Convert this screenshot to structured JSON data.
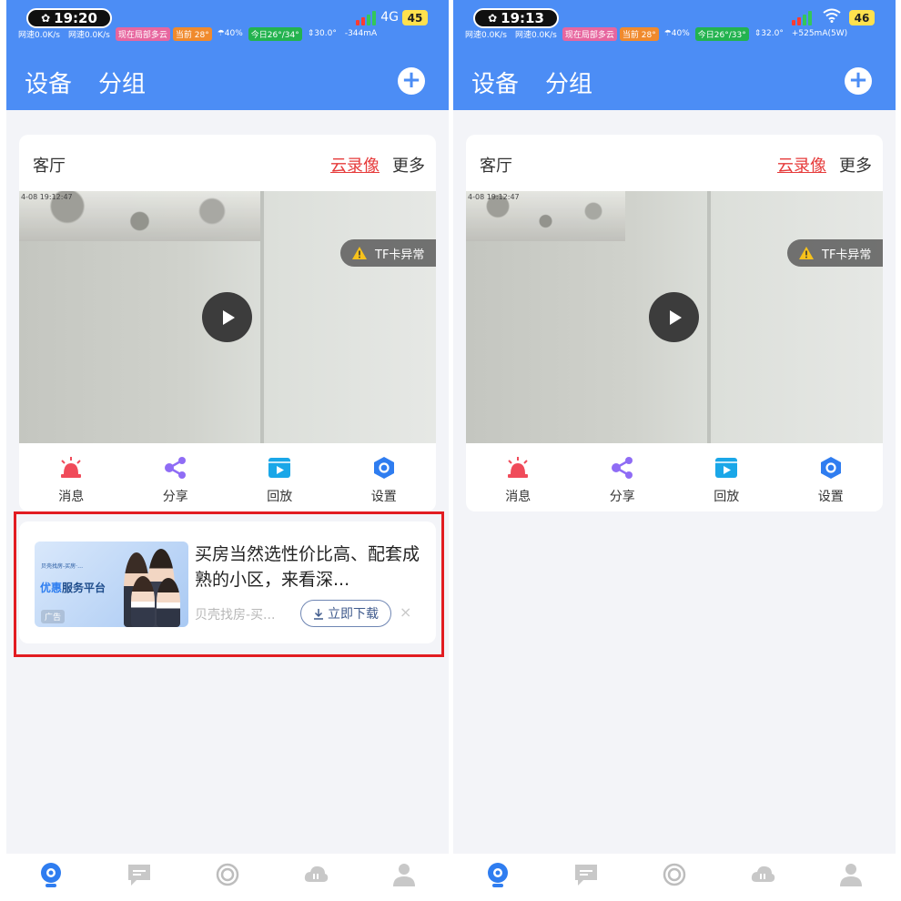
{
  "left_phone": {
    "status": {
      "time": "19:20",
      "network": "4G",
      "battery": "45",
      "tags": [
        {
          "text": "网速0.0K/s",
          "style": "plain"
        },
        {
          "text": "网速0.0K/s",
          "style": "plain"
        },
        {
          "text": "现在局部多云",
          "style": "pink"
        },
        {
          "text": "当前 28°",
          "style": "orange"
        },
        {
          "text": "☂40%",
          "style": "plain"
        },
        {
          "text": "今日26°/34°",
          "style": "green"
        },
        {
          "text": "⇕30.0°",
          "style": "plain"
        },
        {
          "text": "-344mA",
          "style": "plain"
        }
      ]
    },
    "header": {
      "tab_devices": "设备",
      "tab_groups": "分组"
    },
    "card": {
      "title": "客厅",
      "cloud_record": "云录像",
      "more": "更多",
      "timestamp": "4-08 19:12:47",
      "tf_status": "TF卡异常",
      "actions": {
        "message": "消息",
        "share": "分享",
        "playback": "回放",
        "settings": "设置"
      }
    },
    "ad": {
      "title": "买房当然选性价比高、配套成熟的小区，来看深...",
      "source": "贝壳找房-买...",
      "download": "立即下载",
      "close": "×",
      "image_small": "贝壳找房-买房·…",
      "image_big_hl": "优惠",
      "image_big": "服务平台",
      "image_tag": "广告"
    }
  },
  "right_phone": {
    "status": {
      "time": "19:13",
      "battery": "46",
      "tags": [
        {
          "text": "网速0.0K/s",
          "style": "plain"
        },
        {
          "text": "网速0.0K/s",
          "style": "plain"
        },
        {
          "text": "现在局部多云",
          "style": "pink"
        },
        {
          "text": "当前 28°",
          "style": "orange"
        },
        {
          "text": "☂40%",
          "style": "plain"
        },
        {
          "text": "今日26°/33°",
          "style": "green"
        },
        {
          "text": "⇕32.0°",
          "style": "plain"
        },
        {
          "text": "+525mA(5W)",
          "style": "plain"
        }
      ]
    },
    "header": {
      "tab_devices": "设备",
      "tab_groups": "分组"
    },
    "card": {
      "title": "客厅",
      "cloud_record": "云录像",
      "more": "更多",
      "timestamp": "4-08 19:12:47",
      "tf_status": "TF卡异常",
      "actions": {
        "message": "消息",
        "share": "分享",
        "playback": "回放",
        "settings": "设置"
      }
    }
  },
  "colors": {
    "header_blue": "#4c8df5",
    "highlight_red": "#e21c21",
    "cloud_record_red": "#e63a3a"
  },
  "icons": [
    "add-icon",
    "play-icon",
    "warning-icon",
    "alarm-light-icon",
    "share-icon",
    "playback-icon",
    "settings-hexagon-icon",
    "download-icon",
    "close-icon",
    "camera-tab-icon",
    "message-tab-icon",
    "circle-tab-icon",
    "cloud-tab-icon",
    "person-tab-icon",
    "double-arrow-icon"
  ]
}
